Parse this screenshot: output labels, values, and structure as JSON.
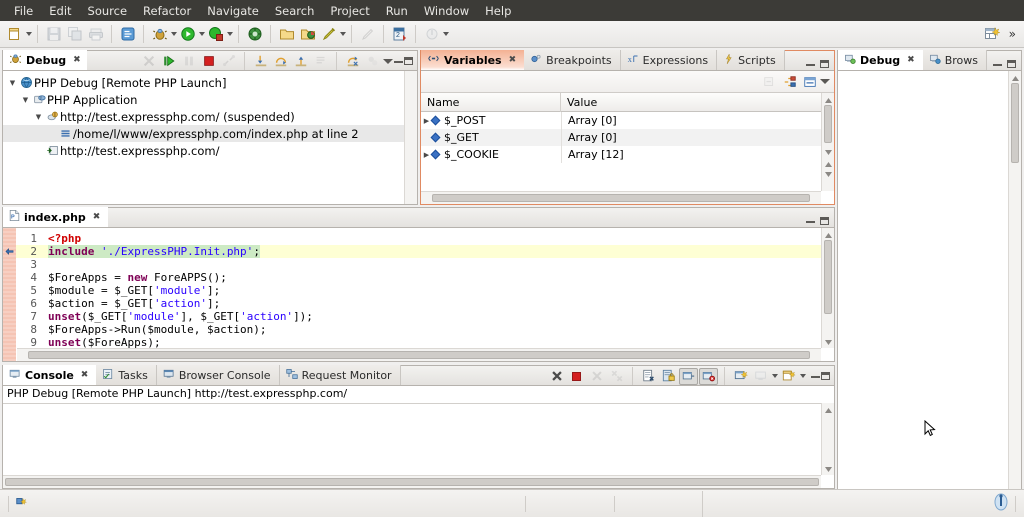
{
  "menubar": {
    "items": [
      "File",
      "Edit",
      "Source",
      "Refactor",
      "Navigate",
      "Search",
      "Project",
      "Run",
      "Window",
      "Help"
    ]
  },
  "toolbar": {
    "icons": [
      {
        "name": "new-wizard-icon",
        "label": "New"
      },
      {
        "name": "save-icon",
        "label": "Save"
      },
      {
        "name": "save-all-icon",
        "label": "Save All"
      },
      {
        "name": "print-icon",
        "label": "Print"
      },
      {
        "name": "open-type-icon",
        "label": "Open Type"
      },
      {
        "name": "debug-icon",
        "label": "Debug"
      },
      {
        "name": "run-icon",
        "label": "Run"
      },
      {
        "name": "external-tools-icon",
        "label": "External Tools"
      },
      {
        "name": "profile-icon",
        "label": "Profile"
      },
      {
        "name": "open-folder-icon",
        "label": "Open Folder"
      },
      {
        "name": "open-project-icon",
        "label": "Open Project"
      },
      {
        "name": "build-icon",
        "label": "Build"
      },
      {
        "name": "pen-icon",
        "label": "Annotate"
      },
      {
        "name": "next-annotation-icon",
        "label": "Next Annotation"
      },
      {
        "name": "previous-annotation-icon",
        "label": "Previous Annotation"
      }
    ],
    "perspective_icon": "open-perspective-icon",
    "overflow_label": "»"
  },
  "debug_view": {
    "tab_label": "Debug",
    "tab_close": "✖",
    "toolbar_icons": [
      "remove-all-terminated-icon",
      "resume-icon",
      "suspend-icon",
      "terminate-icon",
      "disconnect-icon",
      "step-into-icon",
      "step-over-icon",
      "step-return-icon",
      "drop-to-frame-icon",
      "use-step-filters-icon",
      "view-menu-icon"
    ],
    "tree": [
      {
        "label": "PHP Debug [Remote PHP Launch]",
        "icon": "launch-config-icon",
        "depth": 0,
        "expanded": true,
        "selected": false
      },
      {
        "label": "PHP Application",
        "icon": "php-application-icon",
        "depth": 1,
        "expanded": true,
        "selected": false
      },
      {
        "label": "http://test.expressphp.com/ (suspended)",
        "icon": "thread-icon",
        "depth": 2,
        "expanded": true,
        "selected": false
      },
      {
        "label": "/home/l/www/expressphp.com/index.php at line 2",
        "icon": "stack-frame-icon",
        "depth": 3,
        "expanded": false,
        "selected": true
      },
      {
        "label": "http://test.expressphp.com/",
        "icon": "process-icon",
        "depth": 2,
        "expanded": false,
        "selected": false
      }
    ]
  },
  "variables_view": {
    "tabs": [
      {
        "label": "Variables",
        "icon": "variables-icon",
        "active": true,
        "closeable": true
      },
      {
        "label": "Breakpoints",
        "icon": "breakpoints-icon",
        "active": false,
        "closeable": false
      },
      {
        "label": "Expressions",
        "icon": "expressions-icon",
        "active": false,
        "closeable": false
      },
      {
        "label": "Scripts",
        "icon": "scripts-icon",
        "active": false,
        "closeable": false
      }
    ],
    "toolbar_icons": [
      "collapse-all-icon",
      "show-logical-structure-icon",
      "show-detail-pane-icon",
      "view-menu-icon"
    ],
    "columns": [
      "Name",
      "Value"
    ],
    "rows": [
      {
        "name": "$_POST",
        "value": "Array [0]",
        "expandable": true
      },
      {
        "name": "$_GET",
        "value": "Array [0]",
        "expandable": false
      },
      {
        "name": "$_COOKIE",
        "value": "Array [12]",
        "expandable": true
      }
    ]
  },
  "right_view": {
    "tabs": [
      {
        "label": "Debug",
        "icon": "debug-browser-icon",
        "active": true,
        "closeable": true
      },
      {
        "label": "Brows",
        "icon": "browser-icon",
        "active": false,
        "closeable": false
      }
    ]
  },
  "editor": {
    "tab_label": "index.php",
    "tab_icon": "php-file-icon",
    "tab_close": "✖",
    "lines": [
      {
        "n": "1",
        "highlight": false,
        "breakpoint": false,
        "tokens": [
          {
            "t": "<?php",
            "c": "tag"
          }
        ]
      },
      {
        "n": "2",
        "highlight": true,
        "breakpoint": true,
        "tokens": [
          {
            "t": "include",
            "c": "kw"
          },
          {
            "t": " ",
            "c": "var"
          },
          {
            "t": "'./ExpressPHP.Init.php'",
            "c": "str"
          },
          {
            "t": ";",
            "c": "var"
          }
        ]
      },
      {
        "n": "3",
        "highlight": false,
        "breakpoint": false,
        "tokens": []
      },
      {
        "n": "4",
        "highlight": false,
        "breakpoint": false,
        "tokens": [
          {
            "t": "$ForeApps = ",
            "c": "var"
          },
          {
            "t": "new",
            "c": "kw"
          },
          {
            "t": " ForeAPPS();",
            "c": "var"
          }
        ]
      },
      {
        "n": "5",
        "highlight": false,
        "breakpoint": false,
        "tokens": [
          {
            "t": "$module = $_GET[",
            "c": "var"
          },
          {
            "t": "'module'",
            "c": "str"
          },
          {
            "t": "];",
            "c": "var"
          }
        ]
      },
      {
        "n": "6",
        "highlight": false,
        "breakpoint": false,
        "tokens": [
          {
            "t": "$action = $_GET[",
            "c": "var"
          },
          {
            "t": "'action'",
            "c": "str"
          },
          {
            "t": "];",
            "c": "var"
          }
        ]
      },
      {
        "n": "7",
        "highlight": false,
        "breakpoint": false,
        "tokens": [
          {
            "t": "unset",
            "c": "kw"
          },
          {
            "t": "($_GET[",
            "c": "var"
          },
          {
            "t": "'module'",
            "c": "str"
          },
          {
            "t": "], $_GET[",
            "c": "var"
          },
          {
            "t": "'action'",
            "c": "str"
          },
          {
            "t": "]);",
            "c": "var"
          }
        ]
      },
      {
        "n": "8",
        "highlight": false,
        "breakpoint": false,
        "tokens": [
          {
            "t": "$ForeApps->Run($module, $action);",
            "c": "var"
          }
        ]
      },
      {
        "n": "9",
        "highlight": false,
        "breakpoint": false,
        "tokens": [
          {
            "t": "unset",
            "c": "kw"
          },
          {
            "t": "($ForeApps);",
            "c": "var"
          }
        ]
      }
    ]
  },
  "console_view": {
    "tabs": [
      {
        "label": "Console",
        "icon": "console-icon",
        "active": true,
        "closeable": true
      },
      {
        "label": "Tasks",
        "icon": "tasks-icon",
        "active": false,
        "closeable": false
      },
      {
        "label": "Browser Console",
        "icon": "browser-console-icon",
        "active": false,
        "closeable": false
      },
      {
        "label": "Request Monitor",
        "icon": "request-monitor-icon",
        "active": false,
        "closeable": false
      }
    ],
    "toolbar_icons": [
      "terminate-all-icon",
      "terminate-icon",
      "remove-launch-icon",
      "remove-all-launches-icon",
      "clear-console-icon",
      "scroll-lock-icon",
      "show-console-on-output-icon",
      "show-console-on-error-icon",
      "open-console-icon",
      "display-selected-console-icon",
      "new-console-view-icon",
      "view-menu-icon"
    ],
    "header_text": "PHP Debug [Remote PHP Launch] http://test.expressphp.com/",
    "body_text": ""
  },
  "statusbar": {
    "left_icon": "writable-indicator-icon",
    "right_icon": "progress-indicator-icon",
    "text": ""
  },
  "colors": {
    "menubar_bg": "#3c3b37",
    "menubar_fg": "#e8e7e4",
    "panel_bg": "#ffffff",
    "chrome_bg": "#f0efee",
    "active_tab_orange": "#f3b193",
    "selection_green": "#cdeac4",
    "current_line_yellow": "#feffd4",
    "breakpoint_band": "#f5c4b4",
    "keyword": "#7f0055",
    "string": "#2a00ff",
    "tag": "#d00000",
    "tree_selection": "#e8e8e8"
  }
}
